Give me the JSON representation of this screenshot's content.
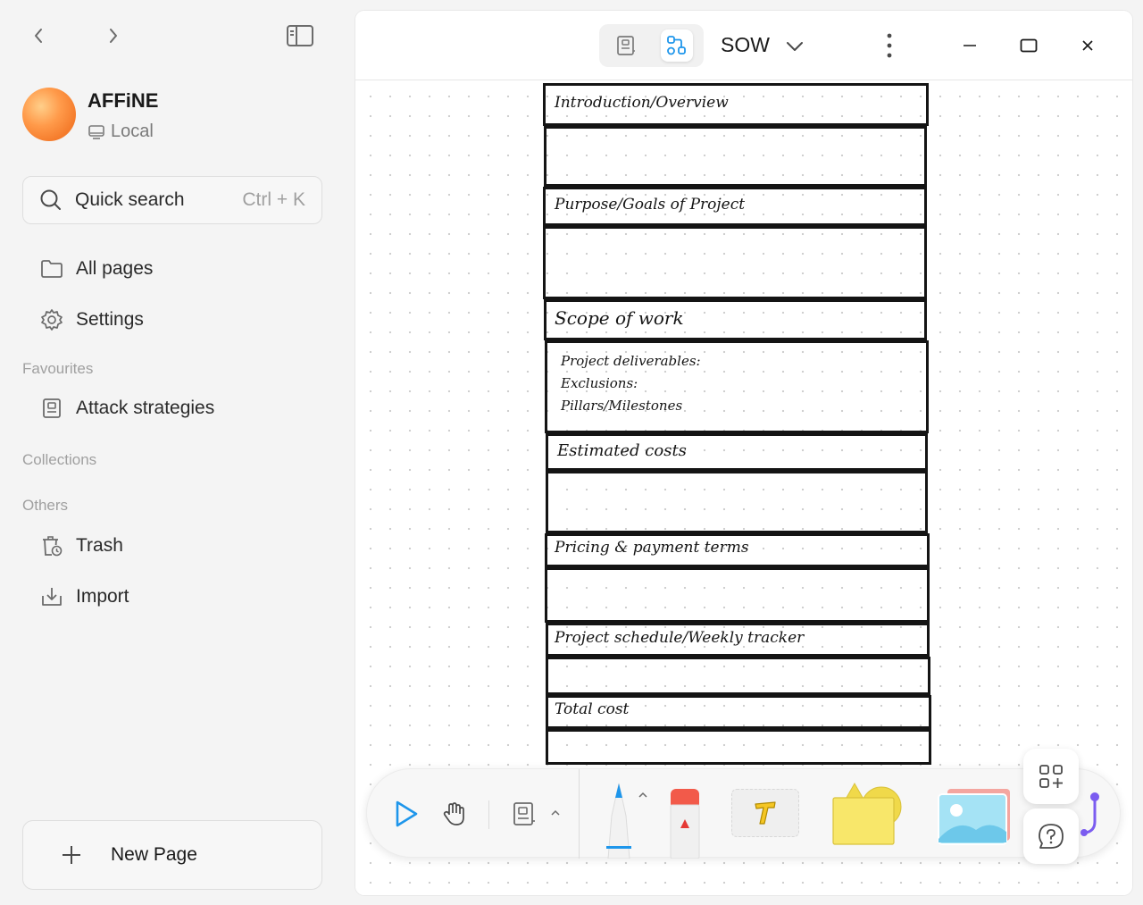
{
  "sidebar": {
    "workspace_name": "AFFiNE",
    "workspace_type": "Local",
    "search_label": "Quick search",
    "search_shortcut": "Ctrl + K",
    "nav": [
      {
        "label": "All pages",
        "icon": "folder-icon"
      },
      {
        "label": "Settings",
        "icon": "gear-icon"
      }
    ],
    "favourites_label": "Favourites",
    "favourites": [
      {
        "label": "Attack strategies",
        "icon": "page-icon"
      }
    ],
    "collections_label": "Collections",
    "others_label": "Others",
    "others": [
      {
        "label": "Trash",
        "icon": "trash-icon"
      },
      {
        "label": "Import",
        "icon": "import-icon"
      }
    ],
    "new_page_label": "New Page"
  },
  "header": {
    "title": "SOW",
    "active_mode": "edgeless"
  },
  "canvas": {
    "sections": [
      "Introduction/Overview",
      "Purpose/Goals of Project",
      "Scope of work",
      "Estimated costs",
      "Pricing & payment terms",
      "Project schedule/Weekly tracker",
      "Total cost"
    ],
    "scope_items": [
      "Project deliverables:",
      "Exclusions:",
      "Pillars/Milestones"
    ]
  },
  "colors": {
    "accent": "#1e96eb",
    "sidebar_bg": "#f4f4f4",
    "canvas_bg": "#ffffff",
    "sticky_note": "#f8e76a"
  }
}
